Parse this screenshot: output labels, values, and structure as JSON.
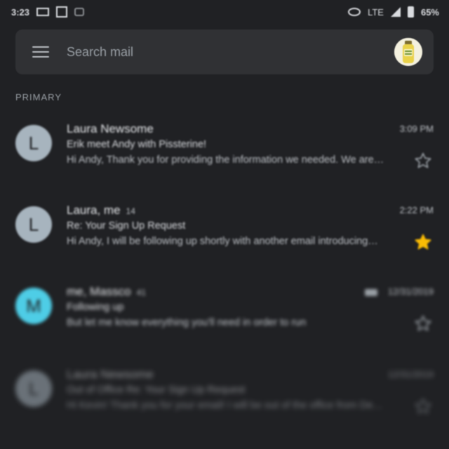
{
  "status_bar": {
    "time": "3:23",
    "network": "LTE",
    "battery": "65%",
    "icons": [
      "laptop-icon",
      "calendar-icon",
      "vibrate-icon",
      "eye-icon",
      "signal-icon",
      "battery-icon"
    ]
  },
  "search": {
    "placeholder": "Search mail",
    "menu_icon": "hamburger-menu-icon",
    "account_icon": "account-avatar-icon"
  },
  "section": {
    "label": "PRIMARY"
  },
  "emails": [
    {
      "avatar_letter": "L",
      "avatar_color": "#a7b4be",
      "sender": "Laura Newsome",
      "count": "",
      "time": "3:09 PM",
      "subject": "Erik meet Andy with Pissterine!",
      "snippet": "Hi Andy, Thank you for providing the information we needed. We are…",
      "starred": false
    },
    {
      "avatar_letter": "L",
      "avatar_color": "#a7b4be",
      "sender": "Laura, me",
      "count": "14",
      "time": "2:22 PM",
      "subject": "Re: Your Sign Up Request",
      "snippet": "Hi Andy, I will be following up shortly with another email introducing…",
      "starred": true
    },
    {
      "avatar_letter": "M",
      "avatar_color": "#4ecde6",
      "sender": "me, Massco",
      "count": "41",
      "time": "12/31/2019",
      "subject": "Following up",
      "snippet": "But let me know everything you'll need in order to run",
      "starred": false,
      "has_attachment": true
    },
    {
      "avatar_letter": "L",
      "avatar_color": "#a7b4be",
      "sender": "Laura Newsome",
      "count": "",
      "time": "12/31/2019",
      "subject": "Out of Office Re: Your Sign Up Request",
      "snippet": "Hi Kevin! Thank you for your email! I will be out of the office from De…",
      "starred": false
    }
  ],
  "colors": {
    "background": "#202124",
    "search_bar": "#303134",
    "star_active": "#fbbc04",
    "star_inactive": "#9aa0a6"
  }
}
